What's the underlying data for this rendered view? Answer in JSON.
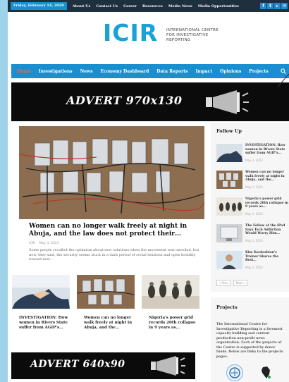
{
  "topbar": {
    "date": "Friday, February 14, 2020",
    "links": [
      "About Us",
      "Contact Us",
      "Career",
      "Resources",
      "Media News",
      "Media Opportunities"
    ],
    "social_icons": [
      "facebook-icon",
      "twitter-icon",
      "youtube-icon",
      "email-icon"
    ]
  },
  "logo": {
    "wordmark": "ICIR",
    "tagline": "INTERNATIONAL CENTRE FOR INVESTIGATIVE REPORTING"
  },
  "nav": {
    "items": [
      "Home",
      "Investigations",
      "News",
      "Economy Dashboard",
      "Data Reports",
      "Impact",
      "Opinions",
      "Projects"
    ],
    "active": "Home"
  },
  "advert_top": {
    "label": "ADVERT 970x130"
  },
  "advert_bottom": {
    "label": "ADVERT 640x90"
  },
  "main_article": {
    "title": "Women can no longer walk freely at night in Abuja, and the law does not protect their…",
    "author": "ICIR",
    "date": "May 3, 2023",
    "excerpt": "Some people recalled the optimism about new solutions when the movement was unveiled, but now, they said, the security seems stuck in a dark period of social tensions and open hostility toward new…"
  },
  "cards": [
    {
      "title": "INVESTIGATION: How women in Rivers State suffer from AGIP's…"
    },
    {
      "title": "Women can no longer walk freely at night in Abuja, and the…"
    },
    {
      "title": "Nigeria's power grid records 20th collapse in 9 years as…"
    }
  ],
  "sidebar": {
    "heading": "Follow Up",
    "items": [
      {
        "title": "INVESTIGATION: How women in Rivers State suffer from AGIP's…",
        "date": "May 3, 2023"
      },
      {
        "title": "Women can no longer walk freely at night in Abuja, and the…",
        "date": "May 3, 2023"
      },
      {
        "title": "Nigeria's power grid records 20th collapse in 9 years as…",
        "date": "May 3, 2023"
      },
      {
        "title": "The Follow of the iPod Says Tech Addiction Would Worry Him…",
        "date": "May 3, 2023"
      },
      {
        "title": "Kim Kardashian's Trainer Shares the Best…",
        "date": "May 3, 2023"
      }
    ],
    "prev_label": "« Prev",
    "next_label": "Next »"
  },
  "projects": {
    "heading": "Projects",
    "text": "The International Centre for Investigative Reporting is a foremost capacity building and content production non-profit news organization. Each of the projects of the Centre is supported by donor funds. Below are links to the projects pages."
  },
  "colors": {
    "brand": "#1a8fcf",
    "logo": "#1aa2d6",
    "active_nav": "#ff5f43",
    "topbar": "#1e2f3d"
  }
}
